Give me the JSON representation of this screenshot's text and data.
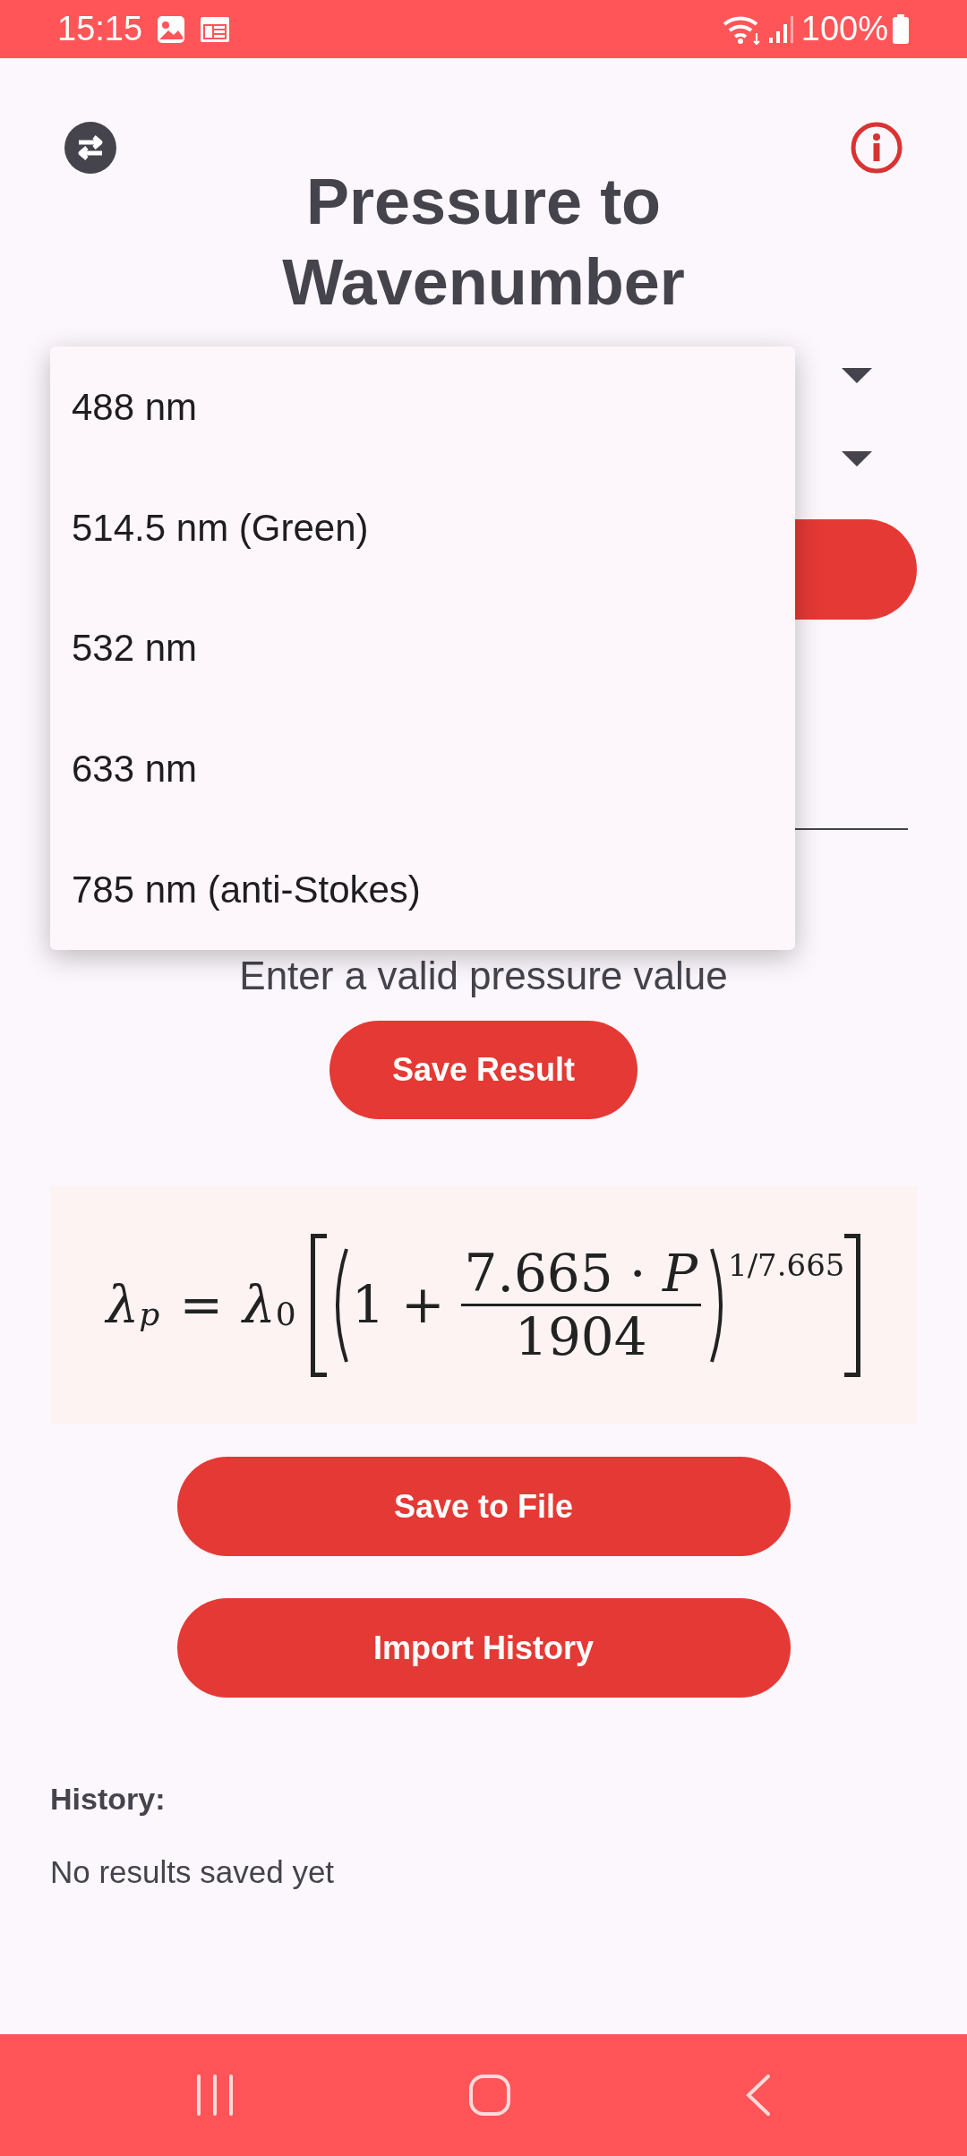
{
  "status_bar": {
    "time": "15:15",
    "battery": "100%"
  },
  "header": {
    "title": "Pressure to Wavenumber"
  },
  "dropdown_menu": {
    "items": [
      {
        "label": "488 nm"
      },
      {
        "label": "514.5 nm (Green)"
      },
      {
        "label": "532 nm"
      },
      {
        "label": "633 nm"
      },
      {
        "label": "785 nm (anti-Stokes)"
      }
    ]
  },
  "error_text": "Enter a valid pressure value",
  "save_result_button": "Save Result",
  "formula": {
    "lhs": "λ",
    "lhs_sub": "p",
    "equals": "=",
    "rhs": "λ",
    "rhs_sub": "0",
    "one_plus": "1 +",
    "numerator": "7.665 · *P*",
    "denominator": "1904",
    "exponent": "1/7.665"
  },
  "buttons": [
    "Save to File",
    "Import History"
  ],
  "history": {
    "heading": "History:",
    "empty_text": "No results saved yet"
  }
}
